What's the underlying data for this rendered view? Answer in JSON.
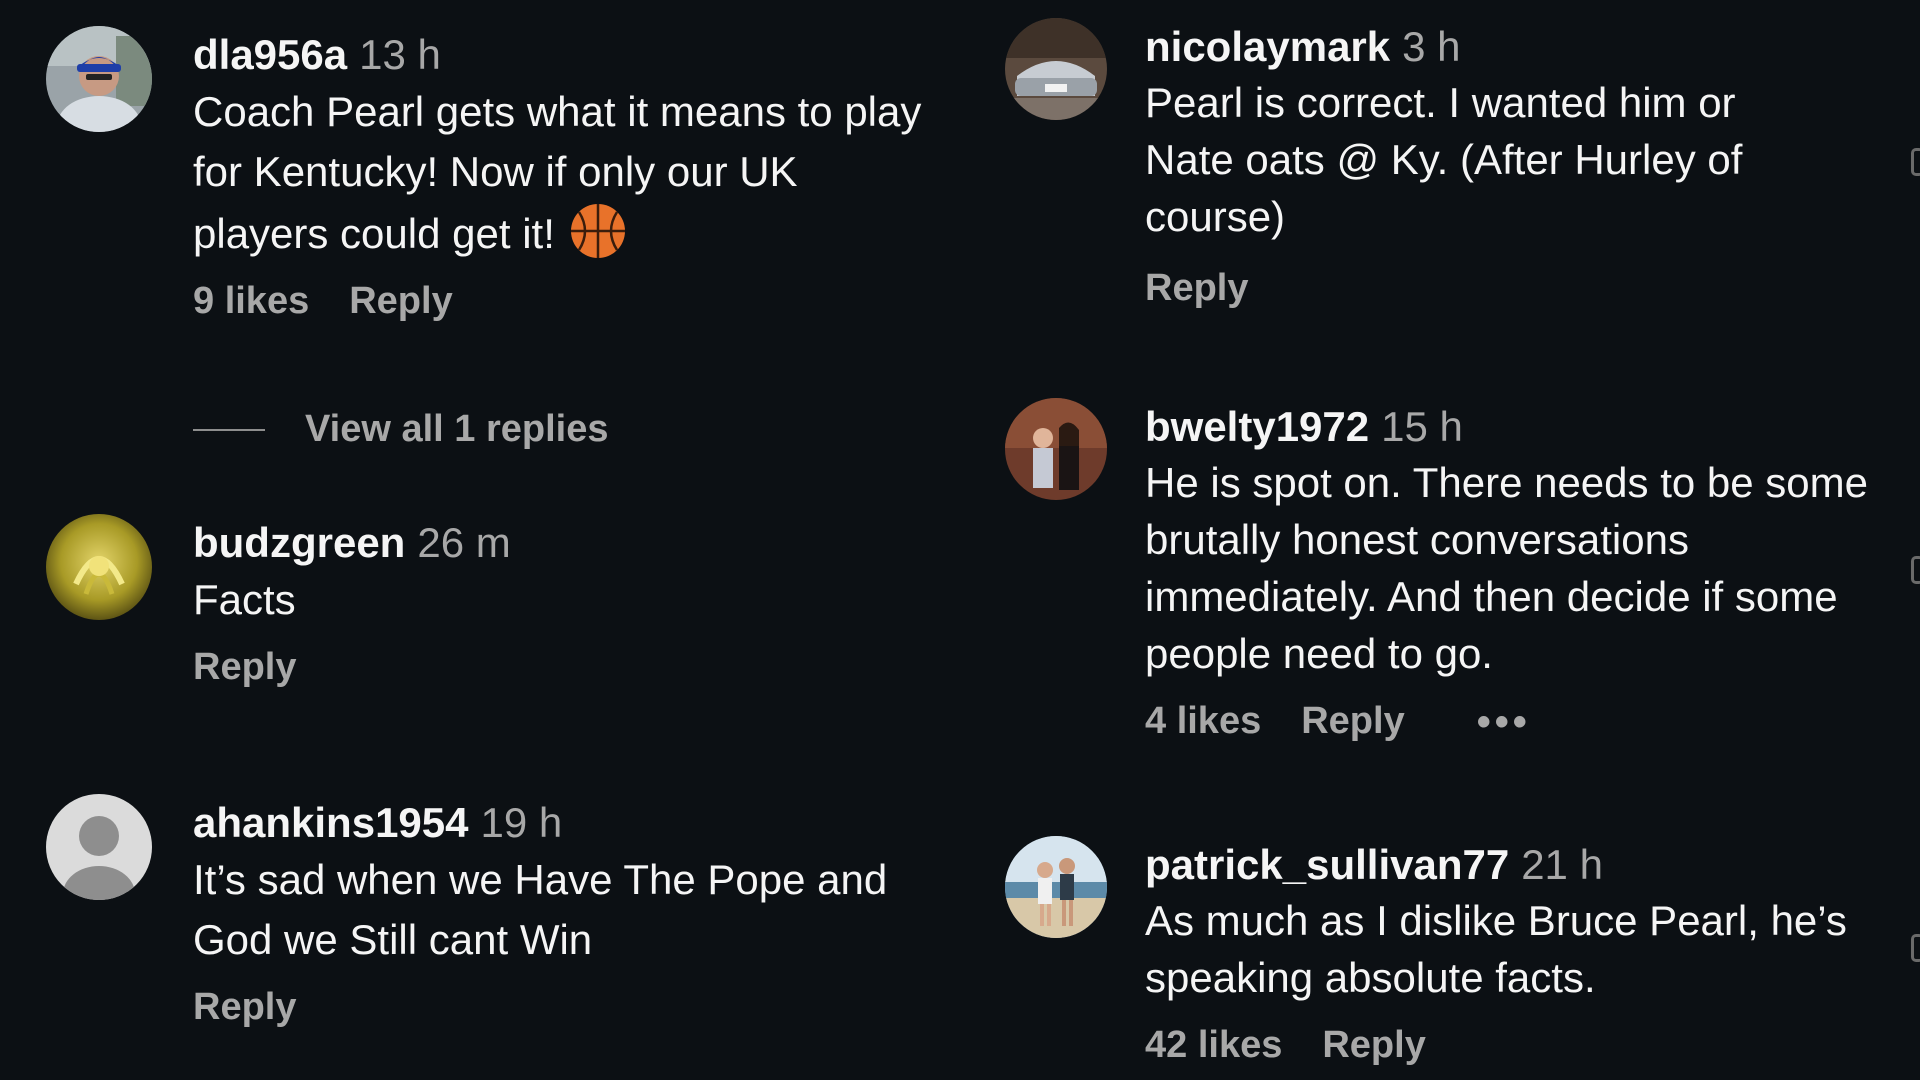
{
  "left_column": [
    {
      "username": "dla956a",
      "time": "13 h",
      "text": "Coach Pearl gets what it means to play for Kentucky! Now if only our UK players could get it!",
      "emoji": "basketball-emoji",
      "likes": "9 likes",
      "reply": "Reply",
      "view_replies": "View all 1 replies"
    },
    {
      "username": "budzgreen",
      "time": "26 m",
      "text": "Facts",
      "reply": "Reply"
    },
    {
      "username": "ahankins1954",
      "time": "19 h",
      "text": "It’s sad when we Have The Pope and God we Still cant Win",
      "reply": "Reply"
    }
  ],
  "right_column": [
    {
      "username": "nicolaymark",
      "time": "3 h",
      "text": "Pearl is correct. I wanted him or Nate oats @ Ky. (After Hurley of course)",
      "reply": "Reply"
    },
    {
      "username": "bwelty1972",
      "time": "15 h",
      "text": "He is spot on. There needs to be some brutally honest conversations immediately. And then decide if some people need to go.",
      "likes": "4 likes",
      "reply": "Reply",
      "more": "•••"
    },
    {
      "username": "patrick_sullivan77",
      "time": "21 h",
      "text": "As much as I dislike Bruce Pearl, he’s speaking absolute facts.",
      "likes": "42 likes",
      "reply": "Reply"
    }
  ],
  "colors": {
    "background": "#0c1014",
    "text": "#f5f5f5",
    "secondary": "#a8a8a8"
  }
}
